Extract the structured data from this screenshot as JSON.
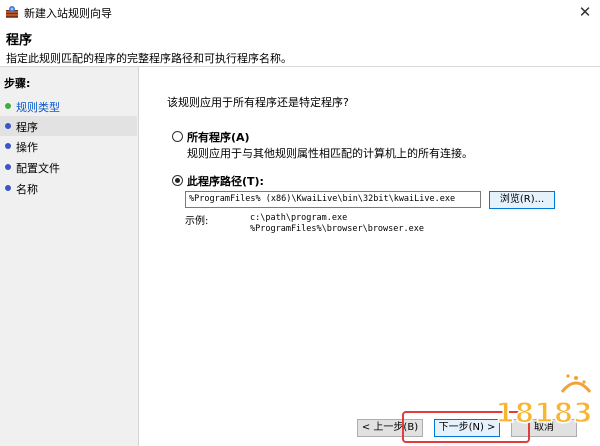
{
  "window": {
    "title": "新建入站规则向导",
    "close_glyph": "✕"
  },
  "header": {
    "title": "程序",
    "subtitle": "指定此规则匹配的程序的完整程序路径和可执行程序名称。"
  },
  "sidebar": {
    "steps_label": "步骤:",
    "items": [
      {
        "label": "规则类型",
        "dot_color": "#3fae3f",
        "text_color": "#0a58ca",
        "active": false
      },
      {
        "label": "程序",
        "dot_color": "#3a55c8",
        "text_color": "#000000",
        "active": true
      },
      {
        "label": "操作",
        "dot_color": "#3a55c8",
        "text_color": "#000000",
        "active": false
      },
      {
        "label": "配置文件",
        "dot_color": "#3a55c8",
        "text_color": "#000000",
        "active": false
      },
      {
        "label": "名称",
        "dot_color": "#3a55c8",
        "text_color": "#000000",
        "active": false
      }
    ]
  },
  "main": {
    "question": "该规则应用于所有程序还是特定程序?",
    "all_programs": {
      "label": "所有程序(A)",
      "description": "规则应用于与其他规则属性相匹配的计算机上的所有连接。",
      "checked": false
    },
    "this_program": {
      "label": "此程序路径(T):",
      "checked": true,
      "path_value": "%ProgramFiles% (x86)\\KwaiLive\\bin\\32bit\\kwaiLive.exe",
      "browse_label": "浏览(R)...",
      "example_label": "示例:",
      "example_lines": [
        "c:\\path\\program.exe",
        "%ProgramFiles%\\browser\\browser.exe"
      ]
    }
  },
  "footer": {
    "back_label": "< 上一步(B)",
    "next_label": "下一步(N) >",
    "cancel_label": "取消"
  },
  "watermark": {
    "text": "18183"
  },
  "colors": {
    "accent": "#0078d7",
    "highlight": "#e43b3b"
  }
}
